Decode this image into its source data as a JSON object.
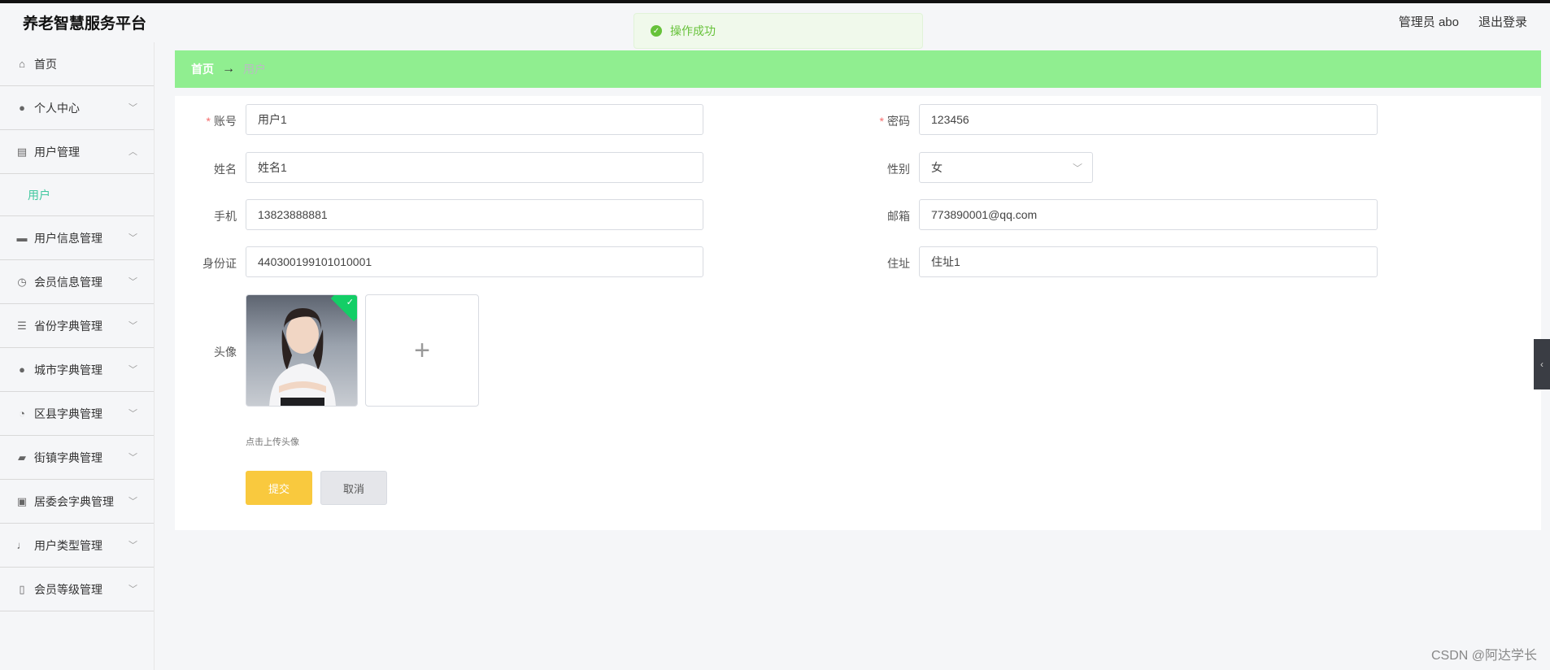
{
  "header": {
    "app_title": "养老智慧服务平台",
    "admin_label": "管理员 abo",
    "logout_label": "退出登录"
  },
  "toast": {
    "message": "操作成功"
  },
  "breadcrumb": {
    "home": "首页",
    "arrow": "→",
    "current": "用户"
  },
  "sidebar": {
    "items": [
      {
        "label": "首页",
        "icon": "home-icon"
      },
      {
        "label": "个人中心",
        "icon": "person-icon"
      },
      {
        "label": "用户管理",
        "icon": "chart-icon"
      },
      {
        "label": "用户",
        "icon": ""
      },
      {
        "label": "用户信息管理",
        "icon": "monitor-icon"
      },
      {
        "label": "会员信息管理",
        "icon": "clock-icon"
      },
      {
        "label": "省份字典管理",
        "icon": "list-icon"
      },
      {
        "label": "城市字典管理",
        "icon": "person-icon"
      },
      {
        "label": "区县字典管理",
        "icon": "compass-icon"
      },
      {
        "label": "街镇字典管理",
        "icon": "ticket-icon"
      },
      {
        "label": "居委会字典管理",
        "icon": "briefcase-icon"
      },
      {
        "label": "用户类型管理",
        "icon": "mic-icon"
      },
      {
        "label": "会员等级管理",
        "icon": "phone-icon"
      }
    ]
  },
  "form": {
    "account": {
      "label": "账号",
      "value": "用户1",
      "required": true
    },
    "password": {
      "label": "密码",
      "value": "123456",
      "required": true
    },
    "name": {
      "label": "姓名",
      "value": "姓名1"
    },
    "gender": {
      "label": "性别",
      "value": "女"
    },
    "phone": {
      "label": "手机",
      "value": "13823888881"
    },
    "email": {
      "label": "邮箱",
      "value": "773890001@qq.com"
    },
    "id_card": {
      "label": "身份证",
      "value": "440300199101010001"
    },
    "address": {
      "label": "住址",
      "value": "住址1"
    },
    "avatar": {
      "label": "头像",
      "hint": "点击上传头像",
      "plus": "+"
    },
    "submit_label": "提交",
    "cancel_label": "取消"
  },
  "required_mark": "*",
  "watermark": "CSDN @阿达学长"
}
